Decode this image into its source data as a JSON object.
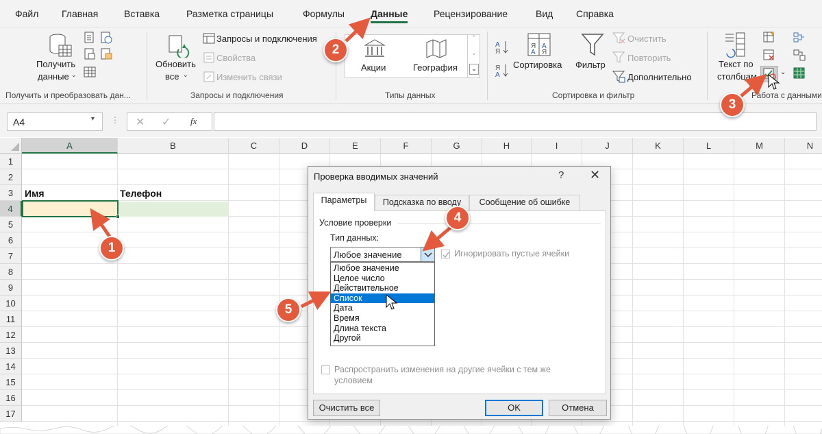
{
  "menu": {
    "tabs": [
      "Файл",
      "Главная",
      "Вставка",
      "Разметка страницы",
      "Формулы",
      "Данные",
      "Рецензирование",
      "Вид",
      "Справка"
    ],
    "active_tab": "Данные"
  },
  "ribbon": {
    "get_data": {
      "label1": "Получить",
      "label2": "данные",
      "group": "Получить и преобразовать дан..."
    },
    "queries": {
      "refresh1": "Обновить",
      "refresh2": "все",
      "item1": "Запросы и подключения",
      "item2": "Свойства",
      "item3": "Изменить связи",
      "group": "Запросы и подключения"
    },
    "data_types": {
      "stocks": "Акции",
      "geography": "География",
      "group": "Типы данных"
    },
    "sort_filter": {
      "sort": "Сортировка",
      "filter": "Фильтр",
      "clear": "Очистить",
      "reapply": "Повторить",
      "advanced": "Дополнительно",
      "group": "Сортировка и фильтр"
    },
    "data_tools": {
      "text_to_cols1": "Текст по",
      "text_to_cols2": "столбцам",
      "group": "Работа с данными"
    }
  },
  "formula_bar": {
    "name_box": "A4",
    "fx": "fx",
    "formula": ""
  },
  "sheet": {
    "columns": [
      "A",
      "B",
      "C",
      "D",
      "E",
      "F",
      "G",
      "H",
      "I",
      "J",
      "K",
      "L",
      "M",
      "N"
    ],
    "rows": [
      "1",
      "2",
      "3",
      "4",
      "5",
      "6",
      "7",
      "8",
      "9",
      "10",
      "11",
      "12",
      "13",
      "14",
      "15",
      "16",
      "17"
    ],
    "selected_cell": "A4",
    "a3": "Имя",
    "b3": "Телефон"
  },
  "dialog": {
    "title": "Проверка вводимых значений",
    "help": "?",
    "close": "✕",
    "tabs": [
      "Параметры",
      "Подсказка по вводу",
      "Сообщение об ошибке"
    ],
    "active_tab": "Параметры",
    "section": "Условие проверки",
    "data_type_label": "Тип данных:",
    "data_type_value": "Любое значение",
    "ignore_blank": "Игнорировать пустые ячейки",
    "options": [
      "Любое значение",
      "Целое число",
      "Действительное",
      "Список",
      "Дата",
      "Время",
      "Длина текста",
      "Другой"
    ],
    "highlighted_option": "Список",
    "apply_all_1": "Распространить изменения на другие ячейки с тем же",
    "apply_all_2": "условием",
    "btn_clear": "Очистить все",
    "btn_ok": "OK",
    "btn_cancel": "Отмена"
  },
  "annotations": [
    "1",
    "2",
    "3",
    "4",
    "5"
  ],
  "colors": {
    "accent": "#217346",
    "highlight": "#0078d7",
    "badge": "#e45a3c",
    "selected_cell": "#fdf0d0",
    "row_fill": "#e2efda"
  }
}
